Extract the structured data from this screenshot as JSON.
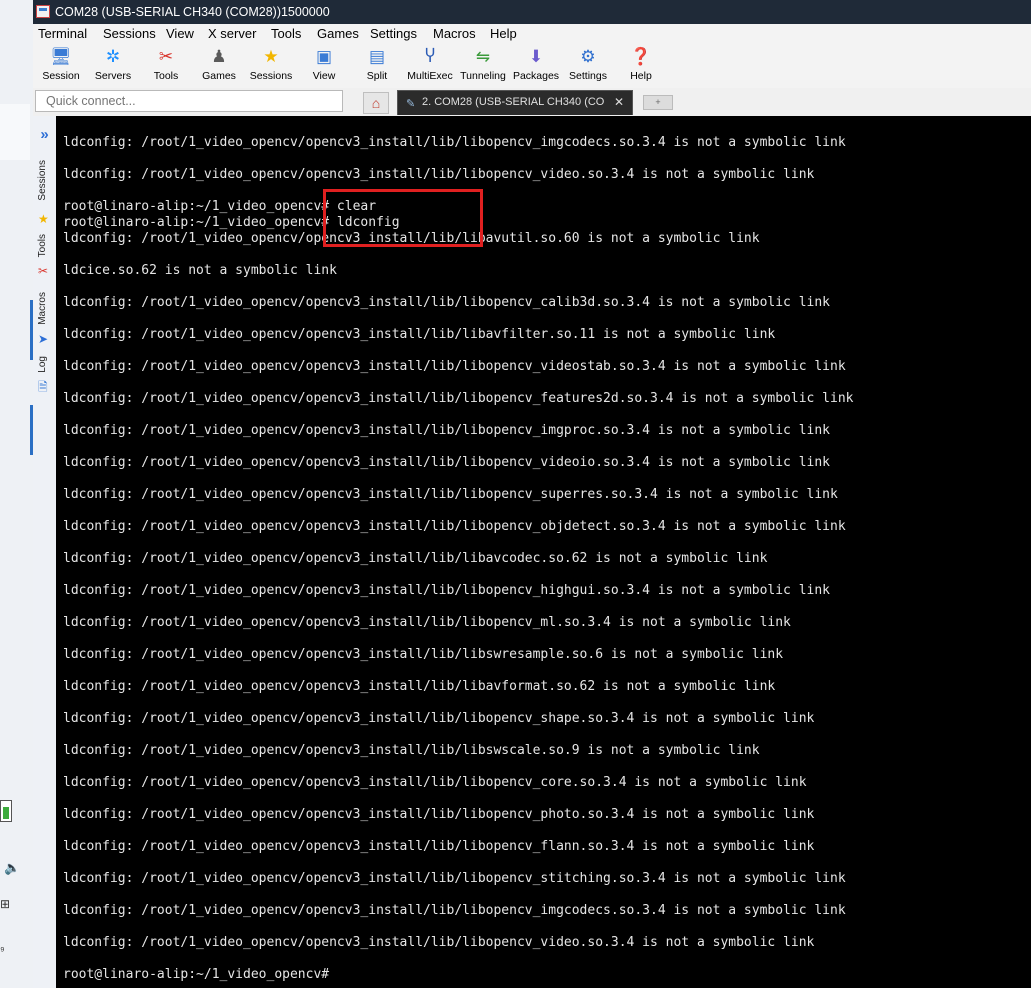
{
  "window": {
    "title": "COM28  (USB-SERIAL CH340 (COM28))1500000"
  },
  "menu": [
    "Terminal",
    "Sessions",
    "View",
    "X server",
    "Tools",
    "Games",
    "Settings",
    "Macros",
    "Help"
  ],
  "toolbar": [
    {
      "label": "Session",
      "icon": "monitor-icon",
      "color": "#3a7bd5"
    },
    {
      "label": "Servers",
      "icon": "servers-icon",
      "color": "#1e90ff"
    },
    {
      "label": "Tools",
      "icon": "tools-icon",
      "color": "#d9342b"
    },
    {
      "label": "Games",
      "icon": "games-icon",
      "color": "#5a5a5a"
    },
    {
      "label": "Sessions",
      "icon": "star-icon",
      "color": "#f2b600"
    },
    {
      "label": "View",
      "icon": "view-icon",
      "color": "#3a7bd5"
    },
    {
      "label": "Split",
      "icon": "split-icon",
      "color": "#3a7bd5"
    },
    {
      "label": "MultiExec",
      "icon": "multiexec-icon",
      "color": "#2b5bb5"
    },
    {
      "label": "Tunneling",
      "icon": "tunneling-icon",
      "color": "#3a9a3a"
    },
    {
      "label": "Packages",
      "icon": "packages-icon",
      "color": "#6a5acd"
    },
    {
      "label": "Settings",
      "icon": "settings-icon",
      "color": "#2f6fcf"
    },
    {
      "label": "Help",
      "icon": "help-icon",
      "color": "#1e88e5"
    }
  ],
  "quick_connect": {
    "placeholder": "Quick connect..."
  },
  "tabs": {
    "active_label": "2. COM28  (USB-SERIAL CH340 (CO"
  },
  "side_tabs": [
    "Sessions",
    "Tools",
    "Macros",
    "Log"
  ],
  "terminal": {
    "lines": [
      {
        "text": "ldconfig: /root/1_video_opencv/opencv3_install/lib/libopencv_imgcodecs.so.3.4 is not a symbolic link"
      },
      {
        "text": "ldconfig: /root/1_video_opencv/opencv3_install/lib/libopencv_video.so.3.4 is not a symbolic link"
      },
      {
        "text": "root@linaro-alip:~/1_video_opencv# clear"
      },
      {
        "text": "root@linaro-alip:~/1_video_opencv# ldconfig"
      },
      {
        "text": "ldconfig: /root/1_video_opencv/opencv3_install/lib/libavutil.so.60 is not a symbolic link"
      },
      {
        "text": "ldcice.so.62 is not a symbolic link"
      },
      {
        "text": "ldconfig: /root/1_video_opencv/opencv3_install/lib/libopencv_calib3d.so.3.4 is not a symbolic link"
      },
      {
        "text": "ldconfig: /root/1_video_opencv/opencv3_install/lib/libavfilter.so.11 is not a symbolic link"
      },
      {
        "text": "ldconfig: /root/1_video_opencv/opencv3_install/lib/libopencv_videostab.so.3.4 is not a symbolic link"
      },
      {
        "text": "ldconfig: /root/1_video_opencv/opencv3_install/lib/libopencv_features2d.so.3.4 is not a symbolic link"
      },
      {
        "text": "ldconfig: /root/1_video_opencv/opencv3_install/lib/libopencv_imgproc.so.3.4 is not a symbolic link"
      },
      {
        "text": "ldconfig: /root/1_video_opencv/opencv3_install/lib/libopencv_videoio.so.3.4 is not a symbolic link"
      },
      {
        "text": "ldconfig: /root/1_video_opencv/opencv3_install/lib/libopencv_superres.so.3.4 is not a symbolic link"
      },
      {
        "text": "ldconfig: /root/1_video_opencv/opencv3_install/lib/libopencv_objdetect.so.3.4 is not a symbolic link"
      },
      {
        "text": "ldconfig: /root/1_video_opencv/opencv3_install/lib/libavcodec.so.62 is not a symbolic link"
      },
      {
        "text": "ldconfig: /root/1_video_opencv/opencv3_install/lib/libopencv_highgui.so.3.4 is not a symbolic link"
      },
      {
        "text": "ldconfig: /root/1_video_opencv/opencv3_install/lib/libopencv_ml.so.3.4 is not a symbolic link"
      },
      {
        "text": "ldconfig: /root/1_video_opencv/opencv3_install/lib/libswresample.so.6 is not a symbolic link"
      },
      {
        "text": "ldconfig: /root/1_video_opencv/opencv3_install/lib/libavformat.so.62 is not a symbolic link"
      },
      {
        "text": "ldconfig: /root/1_video_opencv/opencv3_install/lib/libopencv_shape.so.3.4 is not a symbolic link"
      },
      {
        "text": "ldconfig: /root/1_video_opencv/opencv3_install/lib/libswscale.so.9 is not a symbolic link"
      },
      {
        "text": "ldconfig: /root/1_video_opencv/opencv3_install/lib/libopencv_core.so.3.4 is not a symbolic link"
      },
      {
        "text": "ldconfig: /root/1_video_opencv/opencv3_install/lib/libopencv_photo.so.3.4 is not a symbolic link"
      },
      {
        "text": "ldconfig: /root/1_video_opencv/opencv3_install/lib/libopencv_flann.so.3.4 is not a symbolic link"
      },
      {
        "text": "ldconfig: /root/1_video_opencv/opencv3_install/lib/libopencv_stitching.so.3.4 is not a symbolic link"
      },
      {
        "text": "ldconfig: /root/1_video_opencv/opencv3_install/lib/libopencv_imgcodecs.so.3.4 is not a symbolic link"
      },
      {
        "text": "ldconfig: /root/1_video_opencv/opencv3_install/lib/libopencv_video.so.3.4 is not a symbolic link"
      },
      {
        "text": "root@linaro-alip:~/1_video_opencv#"
      }
    ]
  },
  "colors": {
    "highlight_box": "#e02020",
    "terminal_bg": "#000000",
    "terminal_fg": "#e6e6e6",
    "titlebar_bg": "#1f2a38"
  }
}
